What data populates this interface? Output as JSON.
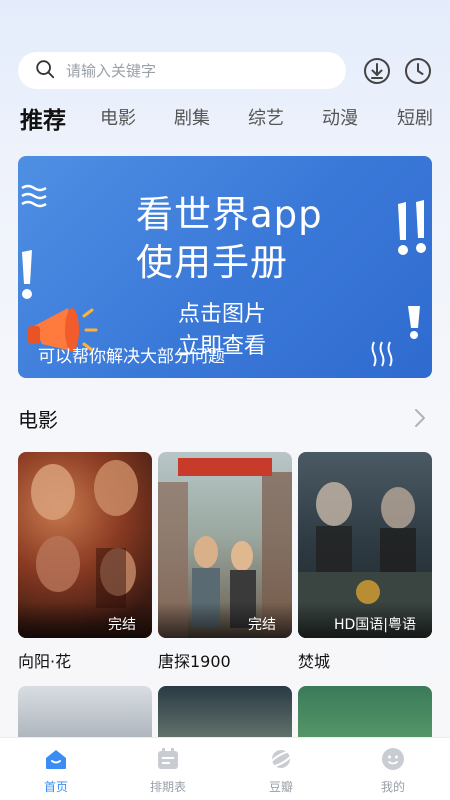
{
  "search": {
    "placeholder": "请输入关键字"
  },
  "tabs": [
    {
      "label": "推荐",
      "active": true
    },
    {
      "label": "电影"
    },
    {
      "label": "剧集"
    },
    {
      "label": "综艺"
    },
    {
      "label": "动漫"
    },
    {
      "label": "短剧"
    }
  ],
  "banner": {
    "line1": "看世界app",
    "line2": "使用手册",
    "line3": "点击图片",
    "line4": "立即查看",
    "caption": "可以帮你解决大部分问题"
  },
  "section": {
    "title": "电影"
  },
  "movies": [
    {
      "title": "向阳·花",
      "badge": "完结"
    },
    {
      "title": "唐探1900",
      "badge": "完结"
    },
    {
      "title": "焚城",
      "badge": "HD国语|粤语"
    }
  ],
  "nav": [
    {
      "label": "首页",
      "active": true
    },
    {
      "label": "排期表"
    },
    {
      "label": "豆瓣"
    },
    {
      "label": "我的"
    }
  ],
  "colors": {
    "accent": "#3a8df5",
    "banner": "#3a78d8"
  },
  "icons": [
    "search-icon",
    "download-icon",
    "history-icon",
    "chevron-right-icon",
    "home-icon",
    "calendar-icon",
    "planet-icon",
    "user-icon"
  ]
}
